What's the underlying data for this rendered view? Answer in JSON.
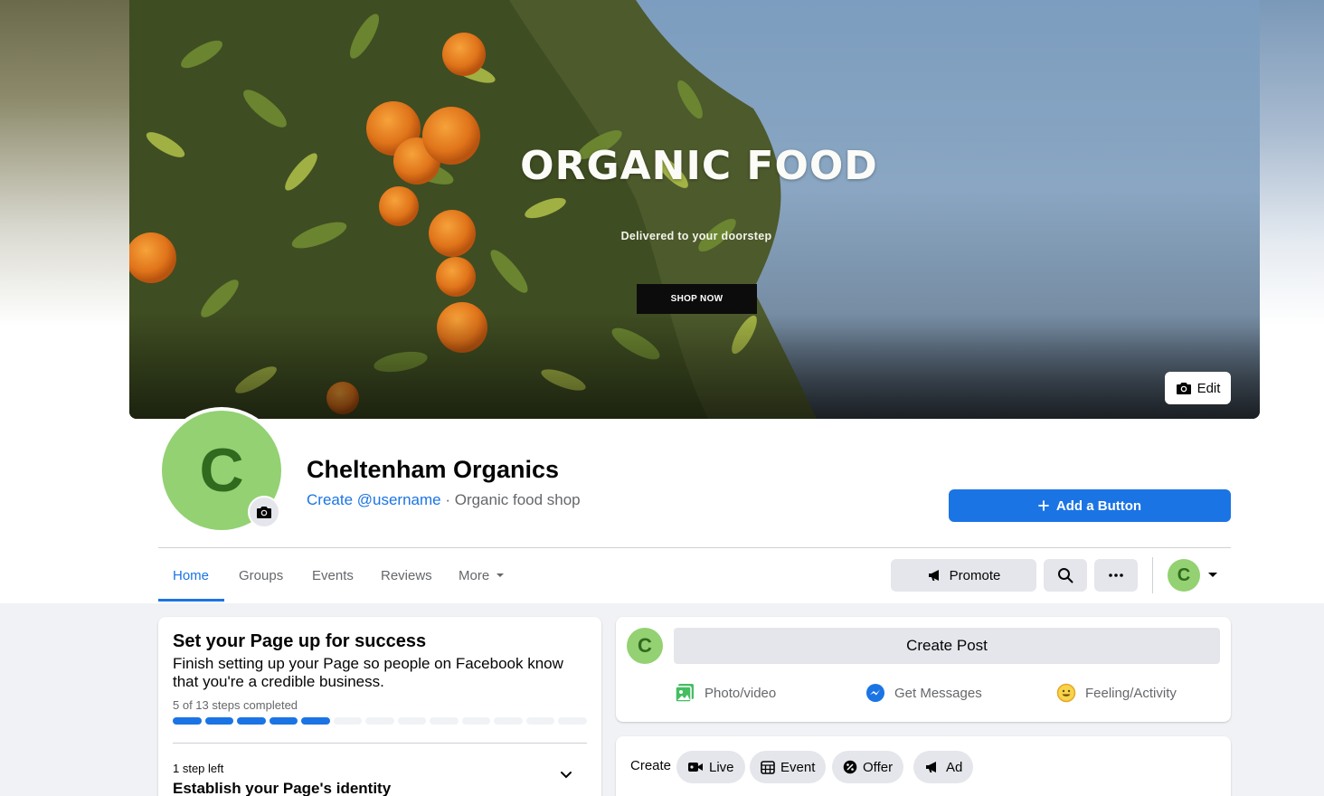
{
  "cover": {
    "title": "ORGANIC FOOD",
    "subtitle": "Delivered to your doorstep",
    "cta": "SHOP NOW",
    "edit_label": "Edit"
  },
  "profile": {
    "avatar_letter": "C",
    "name": "Cheltenham Organics",
    "username_link": "Create @username",
    "separator": " · ",
    "category": "Organic food shop",
    "add_button_label": "Add a Button"
  },
  "tabs": [
    {
      "label": "Home",
      "active": true
    },
    {
      "label": "Groups"
    },
    {
      "label": "Events"
    },
    {
      "label": "Reviews"
    },
    {
      "label": "More"
    }
  ],
  "actions": {
    "promote_label": "Promote",
    "account_letter": "C"
  },
  "setup": {
    "title": "Set your Page up for success",
    "description": "Finish setting up your Page so people on Facebook know that you're a credible business.",
    "progress_text": "5 of 13 steps completed",
    "completed": 5,
    "total": 13,
    "step_left": "1 step left",
    "step_title": "Establish your Page's identity"
  },
  "composer": {
    "avatar_letter": "C",
    "create_post_label": "Create Post",
    "photo_label": "Photo/video",
    "messages_label": "Get Messages",
    "feeling_label": "Feeling/Activity"
  },
  "create_bar": {
    "label": "Create",
    "live": "Live",
    "event": "Event",
    "offer": "Offer",
    "ad": "Ad"
  },
  "colors": {
    "accent": "#1b74e4",
    "avatar_bg": "#93d172",
    "avatar_fg": "#2f6a1e"
  }
}
